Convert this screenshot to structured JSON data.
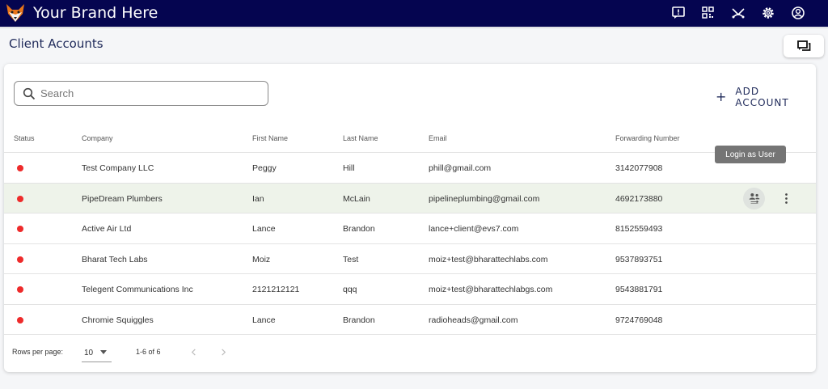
{
  "header": {
    "brand_name": "Your Brand Here",
    "icons": [
      "announcement-icon",
      "dashboard-grid-icon",
      "call-split-icon",
      "settings-gear-icon",
      "account-circle-icon"
    ],
    "background": "#050550"
  },
  "page": {
    "title": "Client Accounts"
  },
  "toolbar": {
    "search_placeholder": "Search",
    "search_value": "",
    "add_account_label": "ADD ACCOUNT"
  },
  "table": {
    "columns": [
      "Status",
      "Company",
      "First Name",
      "Last Name",
      "Email",
      "Forwarding Number"
    ],
    "rows": [
      {
        "status_color": "#ee2b2b",
        "company": "Test Company LLC",
        "first_name": "Peggy",
        "last_name": "Hill",
        "email": "phill@gmail.com",
        "forwarding_number": "3142077908"
      },
      {
        "status_color": "#ee2b2b",
        "company": "PipeDream Plumbers",
        "first_name": "Ian",
        "last_name": "McLain",
        "email": "pipelineplumbing@gmail.com",
        "forwarding_number": "4692173880"
      },
      {
        "status_color": "#ee2b2b",
        "company": "Active Air Ltd",
        "first_name": "Lance",
        "last_name": "Brandon",
        "email": "lance+client@evs7.com",
        "forwarding_number": "8152559493"
      },
      {
        "status_color": "#ee2b2b",
        "company": "Bharat Tech Labs",
        "first_name": "Moiz",
        "last_name": "Test",
        "email": "moiz+test@bharattechlabs.com",
        "forwarding_number": "9537893751"
      },
      {
        "status_color": "#ee2b2b",
        "company": "Telegent Communications Inc",
        "first_name": "2121212121",
        "last_name": "qqq",
        "email": "moiz+test@bharattechlabgs.com",
        "forwarding_number": "9543881791"
      },
      {
        "status_color": "#ee2b2b",
        "company": "Chromie Squiggles",
        "first_name": "Lance",
        "last_name": "Brandon",
        "email": "radioheads@gmail.com",
        "forwarding_number": "9724769048"
      }
    ],
    "hover_row_index": 1,
    "tooltip": "Login as User"
  },
  "pagination": {
    "rows_per_page_label": "Rows per page:",
    "rows_per_page_value": "10",
    "range_label": "1-6 of 6"
  }
}
